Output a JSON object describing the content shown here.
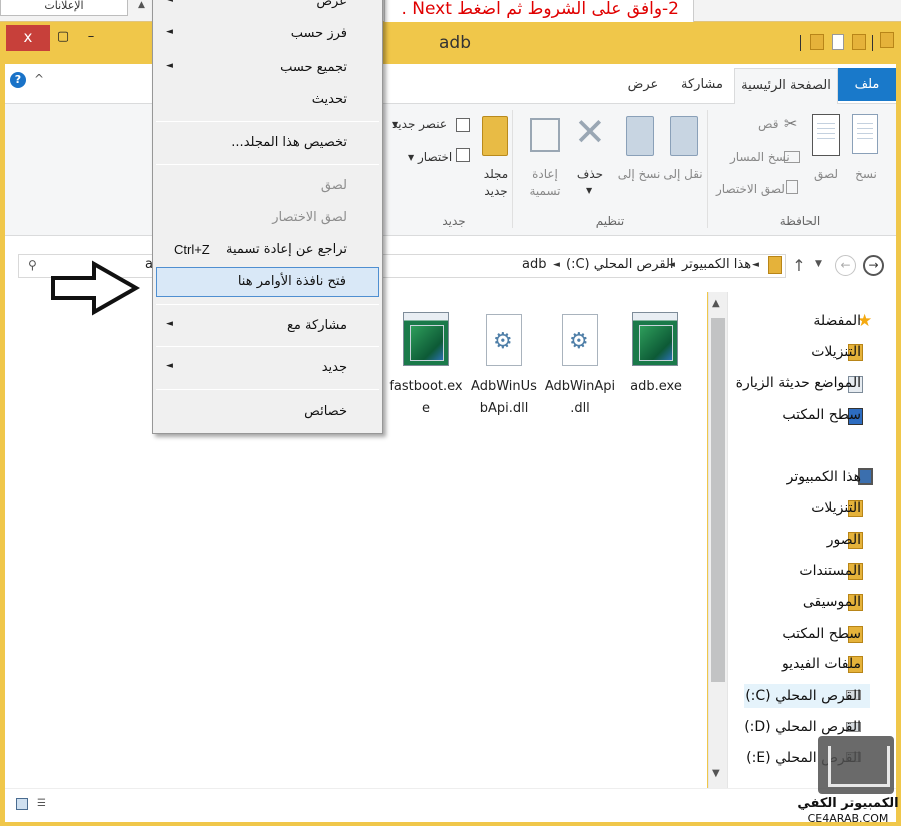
{
  "top_strip": {
    "left_tab": "الإعلانات",
    "instruction": "2-وافق على الشروط ثم اضغط Next ."
  },
  "window": {
    "title": "adb",
    "close_glyph": "x",
    "maximize_glyph": "▢",
    "minimize_glyph": "–"
  },
  "ribbon": {
    "help_glyph": "?",
    "collapse_glyph": "^",
    "tabs": {
      "file": "ملف",
      "home": "الصفحة الرئيسية",
      "share": "مشاركة",
      "view": "عرض"
    },
    "clipboard": {
      "group_label": "الحافظة",
      "copy": "نسخ",
      "paste": "لصق",
      "cut": "قص",
      "copy_path": "نسخ المسار",
      "paste_shortcut": "لصق الاختصار"
    },
    "organize": {
      "group_label": "تنظيم",
      "move_to": "نقل إلى",
      "copy_to": "نسخ إلى",
      "delete": "حذف",
      "rename": "إعادة تسمية"
    },
    "new": {
      "group_label": "جديد",
      "new_folder": "مجلد جديد",
      "new_item": "عنصر جديد",
      "easy_access": "اختصار"
    }
  },
  "address": {
    "crumbs": [
      "هذا الكمبيوتر",
      "القرص المحلي (C:)",
      "adb"
    ],
    "search_visible": "a",
    "up_glyph": "↑",
    "back_glyph": "←",
    "forward_glyph": "→",
    "search_glyph": "⚲"
  },
  "files": [
    {
      "name_line1": "adb.exe",
      "name_line2": "",
      "type": "exe"
    },
    {
      "name_line1": "AdbWinApi",
      "name_line2": ".dll",
      "type": "dll"
    },
    {
      "name_line1": "AdbWinUs",
      "name_line2": "bApi.dll",
      "type": "dll"
    },
    {
      "name_line1": "fastboot.ex",
      "name_line2": "e",
      "type": "exe"
    }
  ],
  "nav_pane": {
    "favorites": "المفضلة",
    "fav_downloads": "التنزيلات",
    "recent_places": "المواضع حديثة الزيارة",
    "fav_desktop": "سطح المكتب",
    "this_pc": "هذا الكمبيوتر",
    "downloads": "التنزيلات",
    "pictures": "الصور",
    "documents": "المستندات",
    "music": "الموسيقى",
    "desktop": "سطح المكتب",
    "videos": "ملفات الفيديو",
    "drive_c": "القرص المحلي (C:)",
    "drive_d": "القرص المحلي (D:)",
    "drive_e": "القرص المحلي (E:)"
  },
  "context_menu": {
    "view": "عرض",
    "sort_by": "فرز حسب",
    "group_by": "تجميع حسب",
    "refresh": "تحديث",
    "customize": "تخصيص هذا المجلد...",
    "paste": "لصق",
    "paste_shortcut": "لصق الاختصار",
    "undo_rename": "تراجع عن إعادة تسمية",
    "undo_shortcut": "Ctrl+Z",
    "open_cmd": "فتح نافذة الأوامر هنا",
    "share_with": "مشاركة مع",
    "new": "جديد",
    "properties": "خصائص"
  },
  "watermark": {
    "text": "الكمبيوتر الكفي",
    "domain": "CE4ARAB.COM"
  },
  "colors": {
    "title_bar": "#f0c74a",
    "file_tab": "#1979ca",
    "close_button": "#c7403a",
    "instruction_text": "#e00000"
  }
}
